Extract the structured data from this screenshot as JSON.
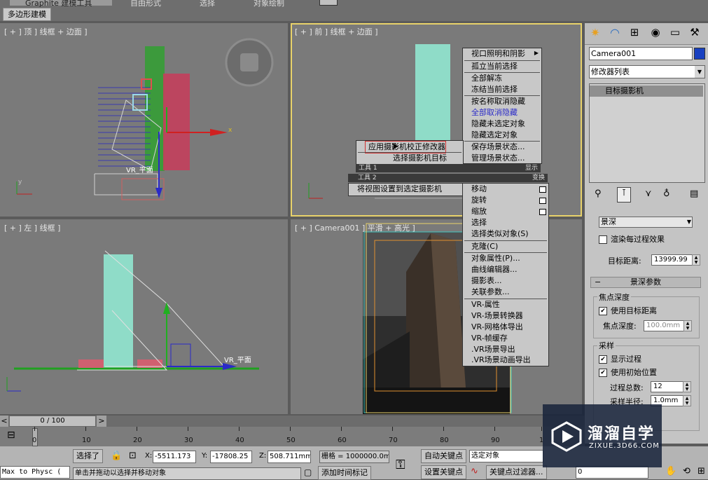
{
  "ribbon": {
    "tab_active": "Graphite 建模工具",
    "tab_freeform": "自由形式",
    "tab_selection": "选择",
    "tab_object_paint": "对象绘制",
    "subtab": "多边形建模"
  },
  "viewports": {
    "top": {
      "label": "[ + ] 顶 ] 线框 + 边面 ]",
      "object_label": "VR_平面",
      "axis_x": "x",
      "axis_y": "y"
    },
    "front": {
      "label": "[ + ] 前 ] 线框 + 边面 ]"
    },
    "left": {
      "label": "[ + ] 左 ] 线框 ]",
      "object_label": "VR_平面"
    },
    "camera": {
      "label": "[ + ] Camera001 ] 平滑 + 高光 ]"
    }
  },
  "quad_menu": {
    "display_items": [
      "视口照明和阴影",
      "孤立当前选择",
      "全部解冻",
      "冻结当前选择",
      "按名称取消隐藏",
      "全部取消隐藏",
      "隐藏未选定对象",
      "隐藏选定对象",
      "保存场景状态...",
      "管理场景状态..."
    ],
    "tools1_items": [
      "应用摄影机校正修改器",
      "选择摄影机目标"
    ],
    "tools1_header": "工具 1",
    "display_header": "显示",
    "tools2_header": "工具 2",
    "transform_header": "变换",
    "tools2_items": [
      "将视图设置到选定摄影机"
    ],
    "transform_items": [
      "移动",
      "旋转",
      "缩放",
      "选择",
      "选择类似对象(S)",
      "克隆(C)",
      "对象属性(P)...",
      "曲线编辑器...",
      "摄影表...",
      "关联参数...",
      "VR-属性",
      "VR-场景转换器",
      "VR-网格体导出",
      "VR-帧缓存",
      ".VR场景导出",
      ".VR场景动画导出"
    ]
  },
  "panel": {
    "object_name": "Camera001",
    "modifier_list": "修改器列表",
    "stack_item": "目标摄影机",
    "dof_dropdown": "景深",
    "render_each_pass": "渲染每过程效果",
    "target_distance_label": "目标距离:",
    "target_distance_value": "13999.99",
    "rollout_dof": "景深参数",
    "focal_depth_group": "焦点深度",
    "use_target_distance": "使用目标距离",
    "focal_depth_label": "焦点深度:",
    "focal_depth_value": "100.0mm",
    "sampling_group": "采样",
    "display_passes": "显示过程",
    "use_original_location": "使用初始位置",
    "total_passes_label": "过程总数:",
    "total_passes_value": "12",
    "sample_radius_label": "采样半径:",
    "sample_radius_value": "1.0mm"
  },
  "timeline": {
    "frame": "0 / 100",
    "prev": "<",
    "next": ">",
    "ticks": [
      "0",
      "10",
      "20",
      "30",
      "40",
      "50",
      "60",
      "70",
      "80",
      "90",
      "1"
    ]
  },
  "status": {
    "selected": "选择了",
    "x_label": "X:",
    "x_value": "-5511.173",
    "y_label": "Y:",
    "y_value": "-17808.25",
    "z_label": "Z:",
    "z_value": "508.711mm",
    "grid_label": "栅格 = 1000000.0mm",
    "auto_key": "自动关键点",
    "set_key": "设置关键点",
    "selected_object": "选定对象",
    "key_filters": "关键点过滤器...",
    "frame_field": "0",
    "prompt": "单击并拖动以选择并移动对象",
    "add_time_tag": "添加时间标记",
    "script_listener": "Max to Physc ("
  },
  "watermark": {
    "title": "溜溜自学",
    "url": "ZIXUE.3D66.COM"
  },
  "colors": {
    "selected_border": "#e8d26a",
    "building": "#8fdcc8",
    "menu_bg": "#c8c8c8",
    "menu_highlight": "#2c2cc8"
  }
}
